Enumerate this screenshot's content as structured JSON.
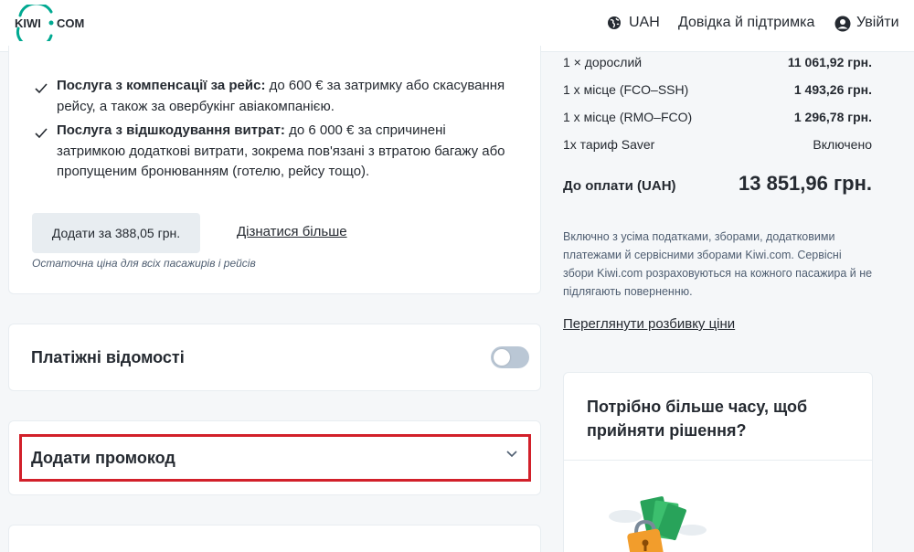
{
  "header": {
    "logo_text": "KIWI · COM",
    "currency": "UAH",
    "help": "Довідка й підтримка",
    "login": "Увійти"
  },
  "protection": {
    "benefits": [
      {
        "bold": "Послуга з компенсації за рейс:",
        "text": " до 600 € за затримку або скасування рейсу, а також за овербукінг авіакомпанією."
      },
      {
        "bold": "Послуга з відшкодування витрат:",
        "text": " до 6 000 € за спричинені затримкою додаткові витрати, зокрема пов'язані з втратою багажу або пропущеним бронюванням (готелю, рейсу тощо)."
      }
    ],
    "add_button": "Додати за 388,05 грн.",
    "learn_more": "Дізнатися більше",
    "final_note": "Остаточна ціна для всіх пасажирів і рейсів"
  },
  "payment": {
    "title": "Платіжні відомості"
  },
  "promo": {
    "title": "Додати промокод"
  },
  "summary": {
    "rows": [
      {
        "label": "1 × дорослий",
        "value": "11 061,92 грн."
      },
      {
        "label": "1 x місце (FCO–SSH)",
        "value": "1 493,26 грн."
      },
      {
        "label": "1 x місце (RMO–FCO)",
        "value": "1 296,78 грн."
      },
      {
        "label": "1x тариф Saver",
        "value": "Включено"
      }
    ],
    "total_label": "До оплати (UAH)",
    "total_value": "13 851,96 грн.",
    "tax_note": "Включно з усіма податками, зборами, додатковими платежами й сервісними зборами Kiwi.com. Сервісні збори Kiwi.com розраховуються на кожного пасажира й не підлягають поверненню.",
    "breakdown_link": "Переглянути розбивку ціни"
  },
  "decision": {
    "title": "Потрібно більше часу, щоб прийняти рішення?"
  },
  "colors": {
    "brand": "#00a991",
    "highlight": "#d2202a",
    "muted": "#4f5e71"
  }
}
